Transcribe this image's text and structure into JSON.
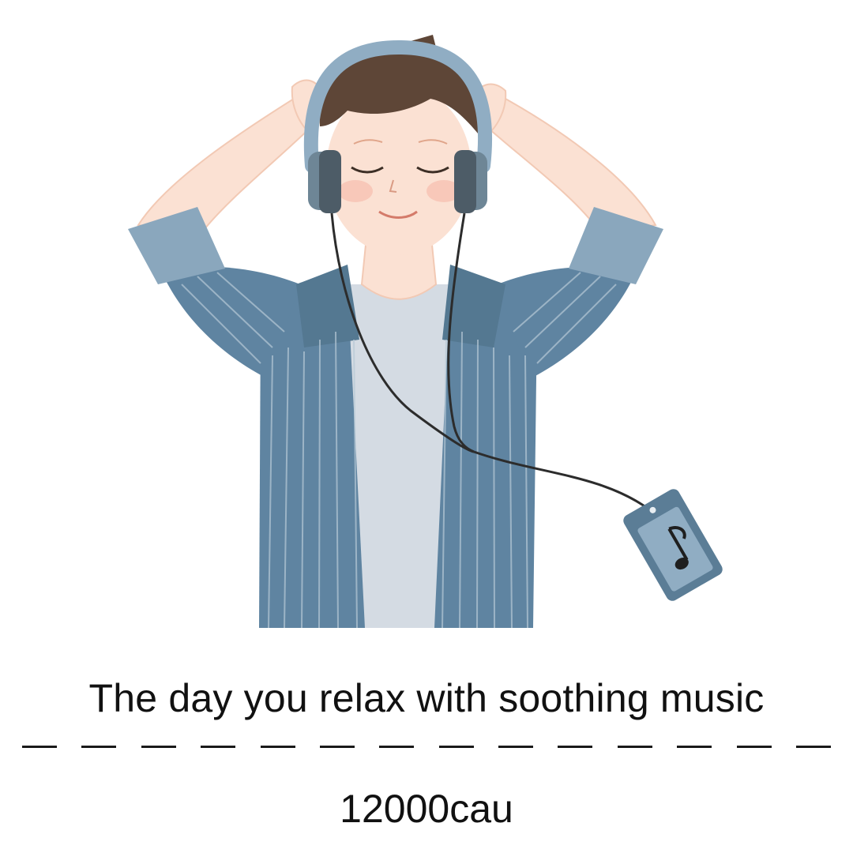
{
  "illustration": {
    "subject": "person-with-headphones",
    "device_icon": "music-note-icon",
    "colors": {
      "shirt": "#5f84a1",
      "shirt_light": "#8aa7bd",
      "tshirt": "#d4dbe3",
      "skin": "#fbe1d3",
      "hair": "#5e4637",
      "headphones": "#90adc3",
      "earcup": "#4d5c67",
      "cable": "#2c2c2c",
      "player": "#5b7d96"
    }
  },
  "caption": {
    "text": "The day you relax with soothing music",
    "dash_count": 14
  },
  "author": {
    "text": "12000cau"
  }
}
